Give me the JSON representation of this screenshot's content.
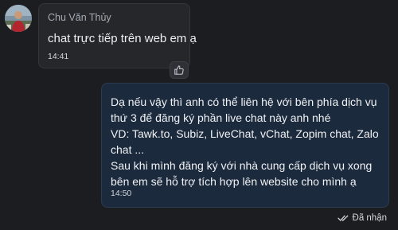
{
  "incoming": {
    "sender_name": "Chu Văn Thủy",
    "text": "chat trực tiếp trên web em ạ",
    "time": "14:41",
    "avatar_icon": "user-avatar",
    "reaction_icon": "thumbs-up-icon"
  },
  "outgoing": {
    "text": "Dạ nếu vậy thì anh có thể liên hệ với bên phía dịch vụ thứ 3 để đăng ký phần live chat này anh nhé\nVD: Tawk.to, Subiz, LiveChat, vChat, Zopim chat, Zalo chat ...\nSau khi mình đăng ký với nhà cung cấp dịch vụ xong bên em sẽ hỗ trợ tích hợp lên website cho mình ạ",
    "time": "14:50",
    "status_label": "Đã nhận",
    "status_icon": "double-check-icon"
  },
  "colors": {
    "background": "#1c1d21",
    "incoming_bubble": "#25272b",
    "outgoing_bubble": "#1c2a3d"
  }
}
